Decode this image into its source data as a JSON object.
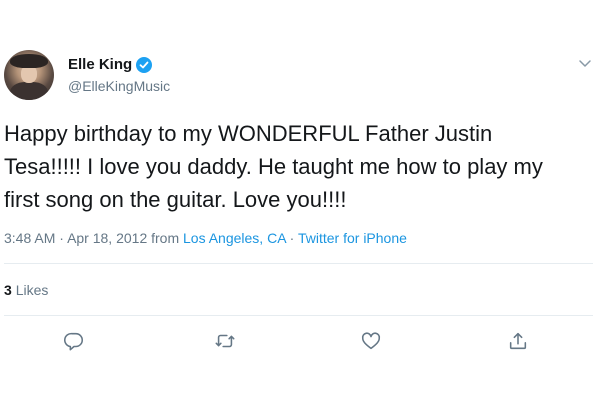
{
  "tweet": {
    "author_name": "Elle King",
    "author_handle": "@ElleKingMusic",
    "verified": true,
    "line1": "Happy birthday to my WONDERFUL Father Justin",
    "line2": "Tesa!!!!! I love you daddy. He taught me how to play my",
    "line3": "first song on the guitar. Love you!!!!",
    "time": "3:48 AM",
    "date": "Apr 18, 2012",
    "from_word": "from",
    "location": "Los Angeles, CA",
    "source": "Twitter for iPhone",
    "separator": "·",
    "likes_count": "3",
    "likes_label": "Likes"
  },
  "colors": {
    "text": "#14171a",
    "muted": "#657786",
    "link": "#1b95e0",
    "verified": "#1da1f2",
    "divider": "#e6ecf0"
  },
  "icons": {
    "more": "chevron-down-icon",
    "reply": "reply-icon",
    "retweet": "retweet-icon",
    "like": "heart-icon",
    "share": "share-icon",
    "verified": "verified-badge-icon"
  }
}
